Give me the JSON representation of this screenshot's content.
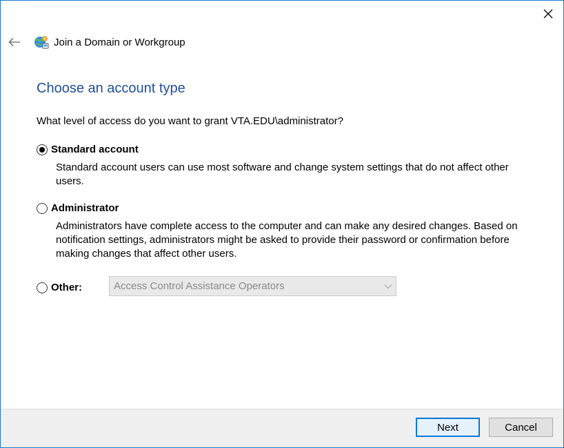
{
  "window": {
    "title": "Join a Domain or Workgroup",
    "close_icon": "close-icon",
    "back_icon": "arrow-left-icon",
    "app_icon": "network-globe-icon"
  },
  "main": {
    "heading": "Choose an account type",
    "question": "What level of access do you want to grant VTA.EDU\\administrator?",
    "options": [
      {
        "label": "Standard account",
        "selected": true,
        "description": "Standard account users can use most software and change system settings that do not affect other users."
      },
      {
        "label": "Administrator",
        "selected": false,
        "description": "Administrators have complete access to the computer and can make any desired changes. Based on notification settings, administrators might be asked to provide their password or confirmation before making changes that affect other users."
      },
      {
        "label": "Other:",
        "selected": false,
        "dropdown_value": "Access Control Assistance Operators",
        "dropdown_enabled": false
      }
    ]
  },
  "footer": {
    "next_label": "Next",
    "cancel_label": "Cancel"
  },
  "colors": {
    "heading": "#1f4e9c",
    "window_border": "#1979ca",
    "primary_button_border": "#0078d7",
    "footer_bg": "#f0f0f0"
  }
}
